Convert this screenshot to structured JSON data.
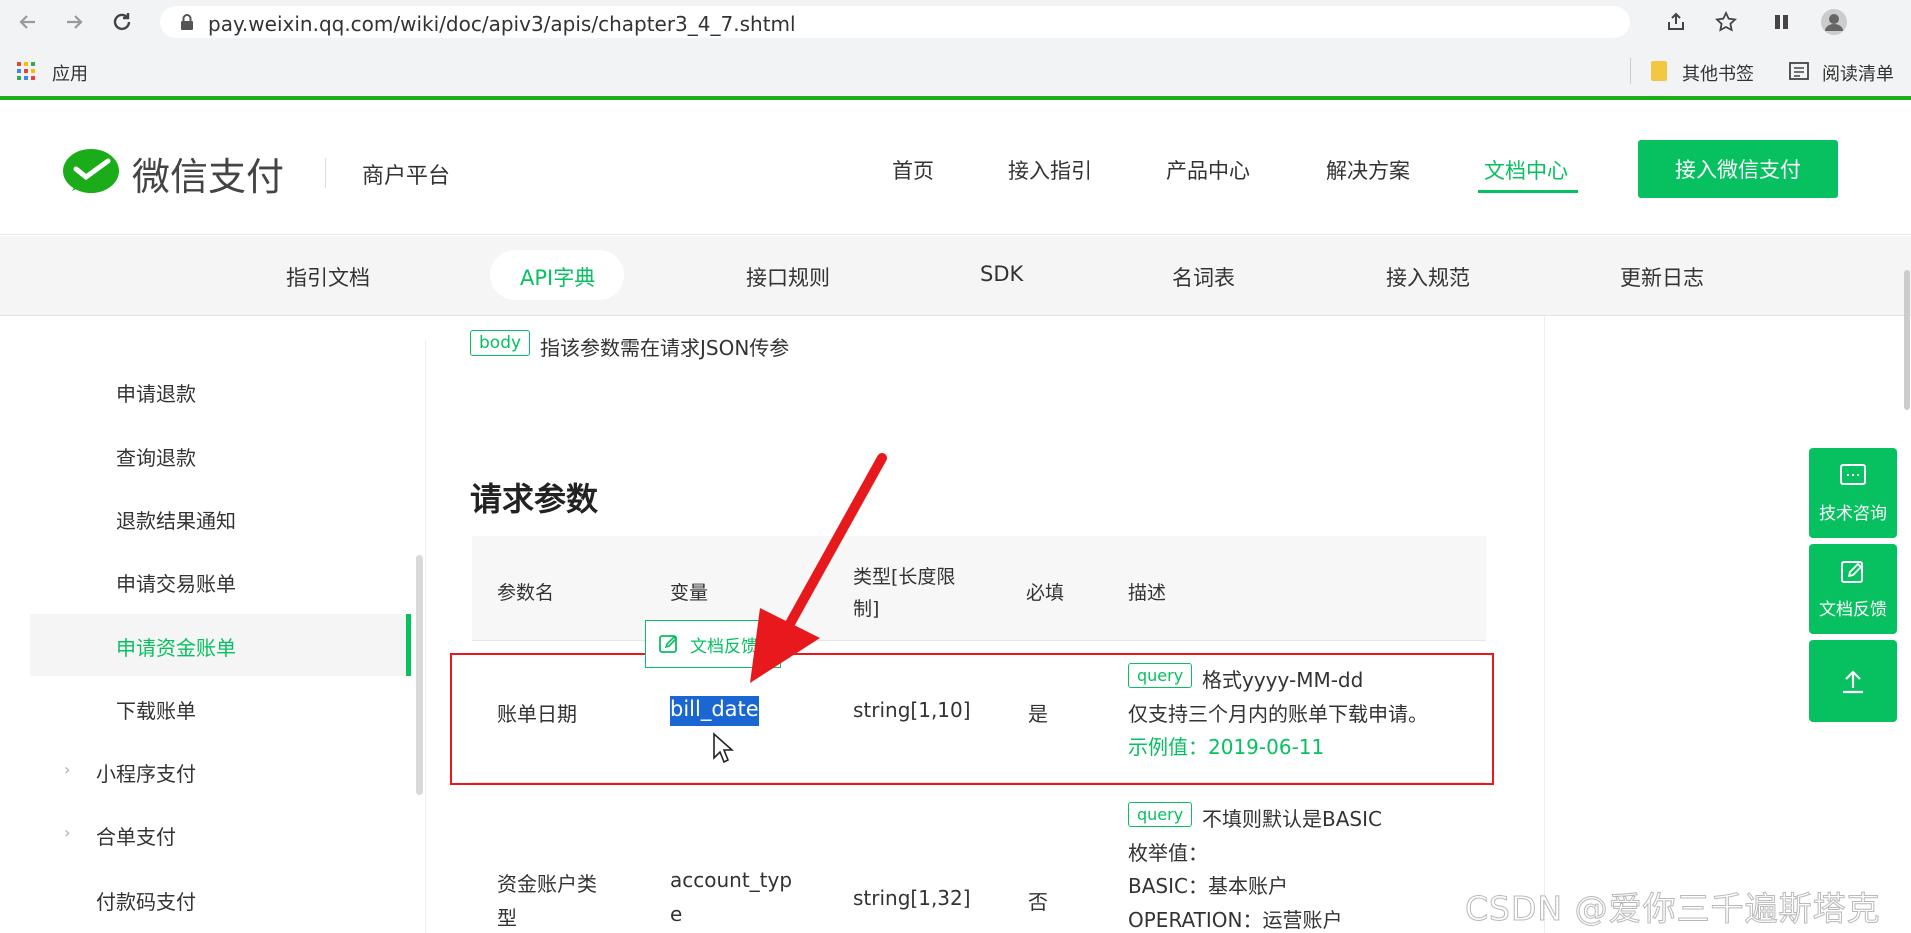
{
  "browser": {
    "url": "pay.weixin.qq.com/wiki/doc/apiv3/apis/chapter3_4_7.shtml",
    "bookmarks": {
      "apps_label": "应用",
      "other_bookmarks": "其他书签",
      "reading_list": "阅读清单"
    },
    "icons": [
      "back-icon",
      "forward-icon",
      "reload-icon",
      "lock-icon",
      "share-icon",
      "star-icon",
      "extension-icon",
      "profile-icon"
    ]
  },
  "site": {
    "brand": "微信支付",
    "platform": "商户平台",
    "nav": [
      "首页",
      "接入指引",
      "产品中心",
      "解决方案",
      "文档中心"
    ],
    "nav_active": "文档中心",
    "cta": "接入微信支付",
    "accent_color": "#07c160"
  },
  "subnav": {
    "tabs": [
      "指引文档",
      "API字典",
      "接口规则",
      "SDK",
      "名词表",
      "接入规范",
      "更新日志"
    ],
    "active": "API字典"
  },
  "sidebar": {
    "items": [
      {
        "label": "申请退款"
      },
      {
        "label": "查询退款"
      },
      {
        "label": "退款结果通知"
      },
      {
        "label": "申请交易账单"
      },
      {
        "label": "申请资金账单",
        "active": true
      },
      {
        "label": "下载账单"
      },
      {
        "label": "小程序支付",
        "expandable": true
      },
      {
        "label": "合单支付",
        "expandable": true
      },
      {
        "label": "付款码支付"
      }
    ]
  },
  "content": {
    "body_tag": "body",
    "body_note": "指该参数需在请求JSON传参",
    "section_title": "请求参数",
    "table": {
      "headers": [
        "参数名",
        "变量",
        "类型[长度限制]",
        "必填",
        "描述"
      ],
      "header_type_line1": "类型[长度限",
      "header_type_line2": "制]",
      "rows": [
        {
          "name": "账单日期",
          "var": "bill_date",
          "type": "string[1,10]",
          "required": "是",
          "tag": "query",
          "desc1": "格式yyyy-MM-dd",
          "desc2": "仅支持三个月内的账单下载申请。",
          "example": "示例值：2019-06-11"
        },
        {
          "name_line1": "资金账户类",
          "name_line2": "型",
          "var_line1": "account_typ",
          "var_line2": "e",
          "type": "string[1,32]",
          "required": "否",
          "tag": "query",
          "desc1": "不填则默认是BASIC",
          "desc2": "枚举值：",
          "desc3": "BASIC：基本账户",
          "desc4": "OPERATION：运营账户"
        }
      ]
    },
    "feedback_popup": "文档反馈"
  },
  "float_buttons": {
    "consult": "技术咨询",
    "feedback": "文档反馈"
  },
  "watermark": "CSDN @爱你三千遍斯塔克"
}
